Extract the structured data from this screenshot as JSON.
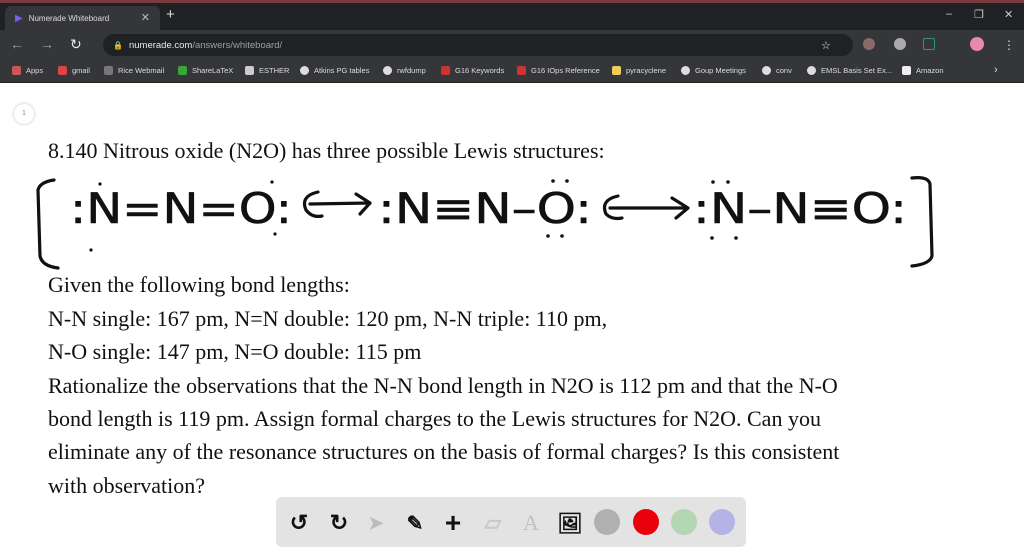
{
  "browser": {
    "tab_title": "Numerade Whiteboard",
    "url_host": "numerade.com",
    "url_path": "/answers/whiteboard/",
    "bookmarks": [
      "Apps",
      "gmail",
      "Rice Webmail",
      "ShareLaTeX",
      "ESTHER",
      "Atkins PG tables",
      "rwfdump",
      "G16 Keywords",
      "G16 IOps Reference",
      "pyracyclene",
      "Goup Meetings",
      "conv",
      "EMSL Basis Set Ex...",
      "Amazon"
    ]
  },
  "page": {
    "page_number": "1",
    "question_title": "8.140 Nitrous oxide (N2O) has three possible Lewis structures:",
    "lines": [
      "Given the following bond lengths:",
      "N-N single: 167 pm, N=N double: 120 pm, N-N triple: 110 pm,",
      "N-O single: 147 pm, N=O double: 115 pm",
      "Rationalize the observations that the N-N bond length in N2O is 112 pm and that the N-O",
      "bond length is 119 pm. Assign formal charges to the Lewis structures for N2O. Can you",
      "eliminate any of the resonance structures on the basis of formal charges? Is this consistent",
      "with observation?"
    ],
    "handwritten_structures": [
      ":N=N=O:",
      ":N≡N–O:",
      ":N–N≡O:"
    ]
  },
  "toolbar": {
    "colors": [
      "#b0b0b0",
      "#e8000b",
      "#b3d6b3",
      "#b3b3e6"
    ]
  }
}
